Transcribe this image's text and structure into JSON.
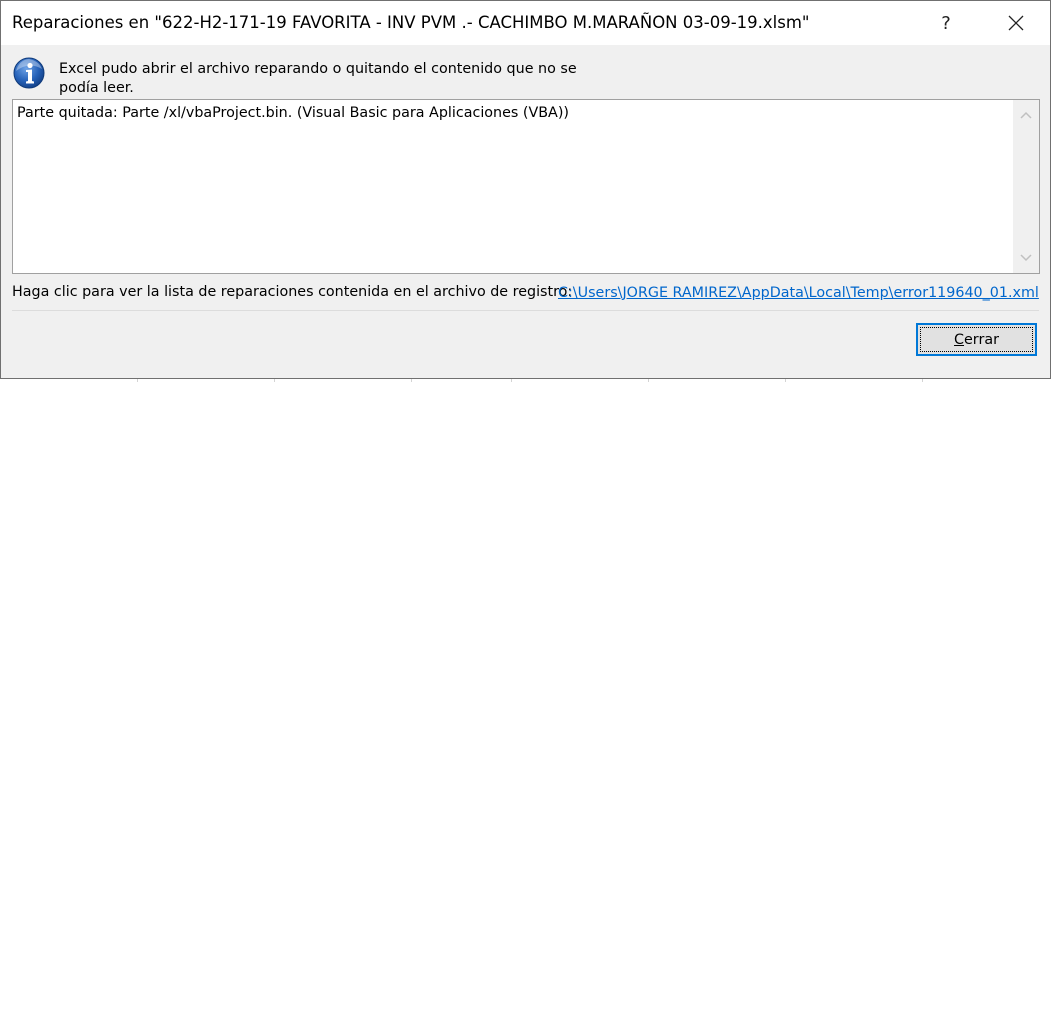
{
  "dialog": {
    "title": "Reparaciones en \"622-H2-171-19 FAVORITA - INV PVM .- CACHIMBO M.MARAÑON 03-09-19.xlsm\"",
    "help_label": "?",
    "icon": "info-icon",
    "message": "Excel pudo abrir el archivo reparando o quitando el contenido que no se podía leer.",
    "repair_items": [
      "Parte quitada: Parte /xl/vbaProject.bin.  (Visual Basic para Aplicaciones (VBA))"
    ],
    "log_label": "Haga clic para ver la lista de reparaciones contenida en el archivo de registro:",
    "log_link": "C:\\Users\\JORGE RAMIREZ\\AppData\\Local\\Temp\\error119640_01.xml",
    "close_button": {
      "accel": "C",
      "rest": "errar"
    }
  },
  "colors": {
    "dialog_bg": "#f0f0f0",
    "titlebar_bg": "#ffffff",
    "link": "#0066cc",
    "focus_border": "#0078d7",
    "icon_blue": "#1f5fb0"
  }
}
